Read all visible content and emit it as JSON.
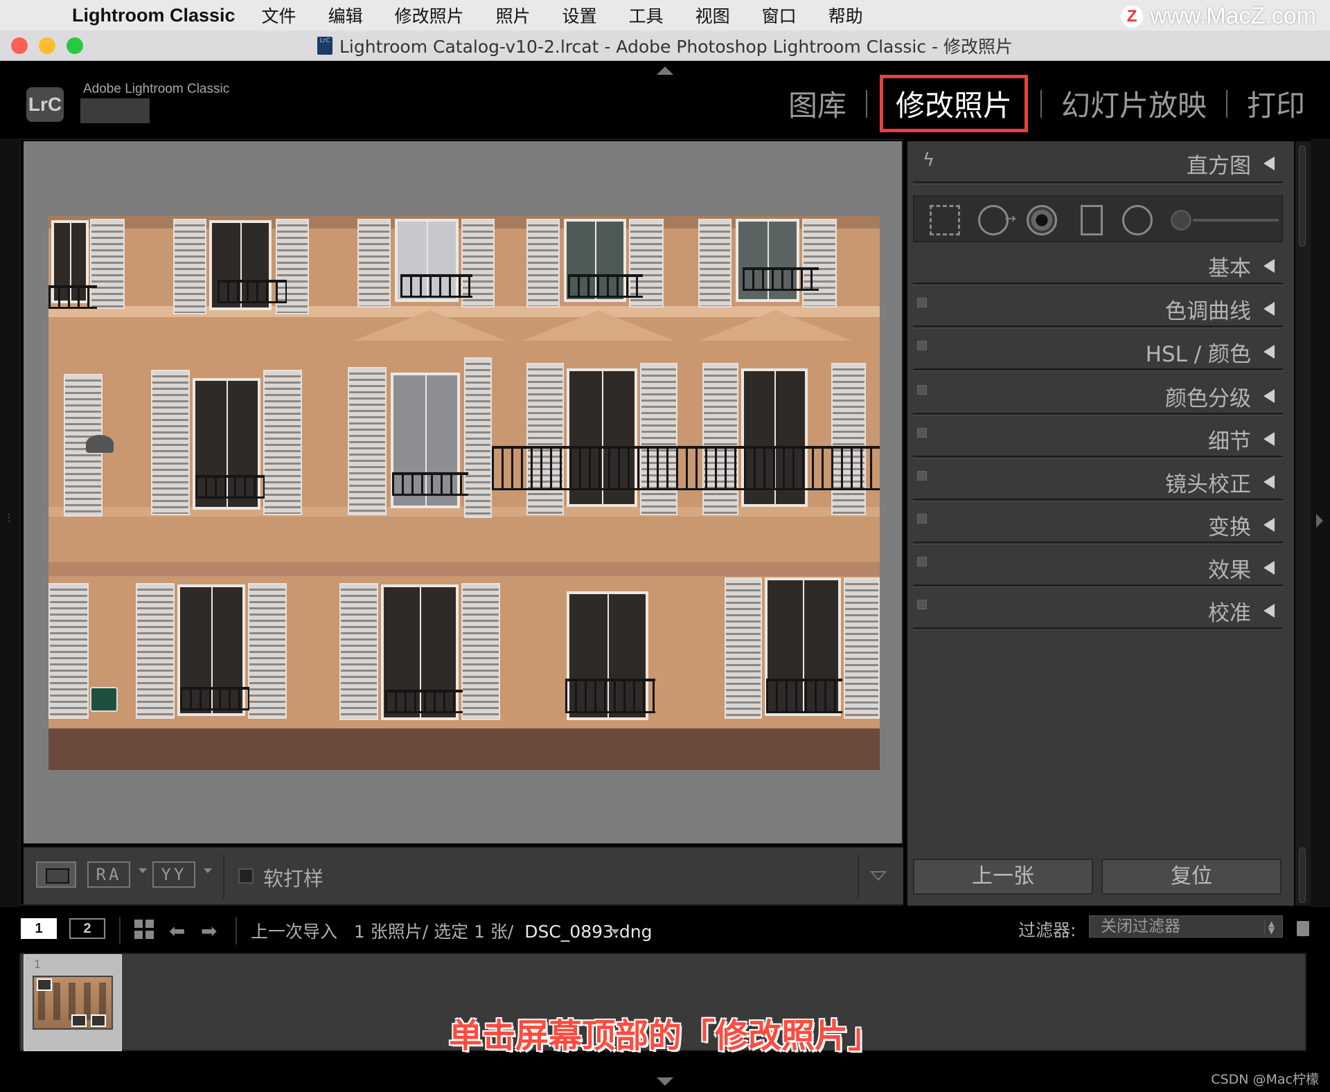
{
  "menubar": {
    "apple_icon": "apple-logo",
    "app_name": "Lightroom Classic",
    "items": [
      "文件",
      "编辑",
      "修改照片",
      "照片",
      "设置",
      "工具",
      "视图",
      "窗口",
      "帮助"
    ],
    "watermark": "www.MacZ.com",
    "watermark_logo": "Z"
  },
  "window": {
    "title": "Lightroom Catalog-v10-2.lrcat - Adobe Photoshop Lightroom Classic - 修改照片",
    "doc_icon_text": "LrC"
  },
  "header": {
    "logo": "LrC",
    "brand": "Adobe Lightroom Classic",
    "modules": [
      {
        "label": "图库",
        "active": false
      },
      {
        "label": "修改照片",
        "active": true
      },
      {
        "label": "幻灯片放映",
        "active": false
      },
      {
        "label": "打印",
        "active": false
      }
    ],
    "highlight_color": "#e4423a"
  },
  "toolbar": {
    "ra_label": "RA",
    "yy_label": "YY",
    "soft_proof_label": "软打样"
  },
  "panel": {
    "histogram_label": "直方图",
    "sections": [
      "基本",
      "色调曲线",
      "HSL / 颜色",
      "颜色分级",
      "细节",
      "镜头校正",
      "变换",
      "效果",
      "校准"
    ],
    "prev_button": "上一张",
    "reset_button": "复位"
  },
  "filmstrip_header": {
    "view1": "1",
    "view2": "2",
    "source": "上一次导入",
    "count": "1 张照片/ 选定 1 张/",
    "filename": "DSC_0893.dng",
    "filter_label": "过滤器:",
    "filter_value": "关闭过滤器"
  },
  "filmstrip": {
    "thumb_index": "1"
  },
  "caption": "单击屏幕顶部的「修改照片」",
  "credit": "CSDN @Mac柠檬"
}
